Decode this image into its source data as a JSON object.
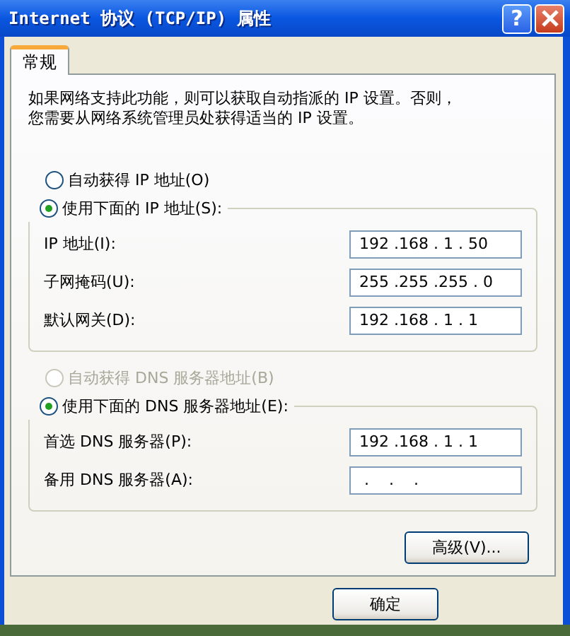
{
  "window": {
    "title": "Internet 协议 (TCP/IP) 属性",
    "help": "?"
  },
  "tabs": [
    {
      "label": "常规",
      "selected": true
    }
  ],
  "description": [
    "如果网络支持此功能，则可以获取自动指派的 IP 设置。否则，",
    "您需要从网络系统管理员处获得适当的 IP 设置。"
  ],
  "ip_section": {
    "options": [
      {
        "label": "自动获得 IP 地址(O)",
        "selected": false,
        "disabled": false
      },
      {
        "label": "使用下面的 IP 地址(S):",
        "selected": true,
        "disabled": false
      }
    ],
    "fields": [
      {
        "label": "IP 地址(I):",
        "value": "192 .168 . 1 . 50"
      },
      {
        "label": "子网掩码(U):",
        "value": "255 .255 .255 . 0"
      },
      {
        "label": "默认网关(D):",
        "value": "192 .168 . 1 . 1"
      }
    ]
  },
  "dns_section": {
    "options": [
      {
        "label": "自动获得 DNS 服务器地址(B)",
        "selected": false,
        "disabled": true
      },
      {
        "label": "使用下面的 DNS 服务器地址(E):",
        "selected": true,
        "disabled": false
      }
    ],
    "fields": [
      {
        "label": "首选 DNS 服务器(P):",
        "value": "192 .168 . 1 . 1"
      },
      {
        "label": "备用 DNS 服务器(A):",
        "value": " .    .    ."
      }
    ]
  },
  "advanced_button": "高级(V)...",
  "ok_button": "确定"
}
